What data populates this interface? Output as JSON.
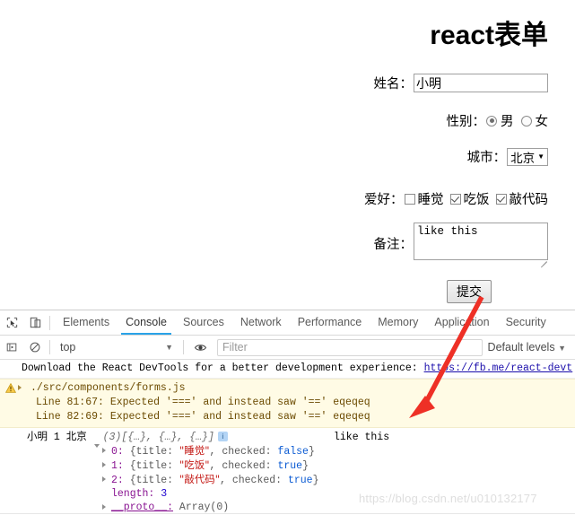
{
  "page": {
    "title": "react表单",
    "name_label": "姓名：",
    "name_value": "小明",
    "gender_label": "性别：",
    "gender_male": "男",
    "gender_female": "女",
    "city_label": "城市：",
    "city_value": "北京",
    "city_caret": "▼",
    "hobby_label": "爱好：",
    "hobby_1": "睡觉",
    "hobby_2": "吃饭",
    "hobby_3": "敲代码",
    "remark_label": "备注：",
    "remark_value": "like this",
    "submit_label": "提交"
  },
  "devtools": {
    "tabs": [
      {
        "label": "Elements",
        "active": false
      },
      {
        "label": "Console",
        "active": true
      },
      {
        "label": "Sources",
        "active": false
      },
      {
        "label": "Network",
        "active": false
      },
      {
        "label": "Performance",
        "active": false
      },
      {
        "label": "Memory",
        "active": false
      },
      {
        "label": "Application",
        "active": false
      },
      {
        "label": "Security",
        "active": false
      }
    ],
    "context": "top",
    "context_caret": "▼",
    "filter_placeholder": "Filter",
    "levels_label": "Default levels",
    "levels_caret": "▼"
  },
  "console": {
    "message_react_devtools": "Download the React DevTools for a better development experience: ",
    "react_devtools_link": "https://fb.me/react-devt",
    "warning_file": "./src/components/forms.js",
    "warning_lines": [
      "Line 81:67:  Expected '===' and instead saw '=='  eqeqeq",
      "Line 82:69:  Expected '===' and instead saw '=='  eqeqeq"
    ],
    "log": {
      "name": "小明",
      "gender": "1",
      "city": "北京",
      "array_header_count": "(3)",
      "array_header_preview": "[{…}, {…}, {…}]",
      "info_badge": "i",
      "right_value": "like this",
      "items": [
        {
          "index": "0:",
          "open": "{title: ",
          "title": "\"睡觉\"",
          "mid": ", checked: ",
          "checked": "false",
          "close": "}"
        },
        {
          "index": "1:",
          "open": "{title: ",
          "title": "\"吃饭\"",
          "mid": ", checked: ",
          "checked": "true",
          "close": "}"
        },
        {
          "index": "2:",
          "open": "{title: ",
          "title": "\"敲代码\"",
          "mid": ", checked: ",
          "checked": "true",
          "close": "}"
        }
      ],
      "length_key": "length:",
      "length_value": "3",
      "proto_key": "__proto__:",
      "proto_value": "Array(0)"
    }
  },
  "watermark": "https://blog.csdn.net/u010132177",
  "colors": {
    "accent": "#2aa3e8",
    "warn_bg": "#fffbe5",
    "arrow": "#ee3026",
    "link": "#1a0dab",
    "string": "#c41a16",
    "boolean": "#0b5bd3"
  }
}
